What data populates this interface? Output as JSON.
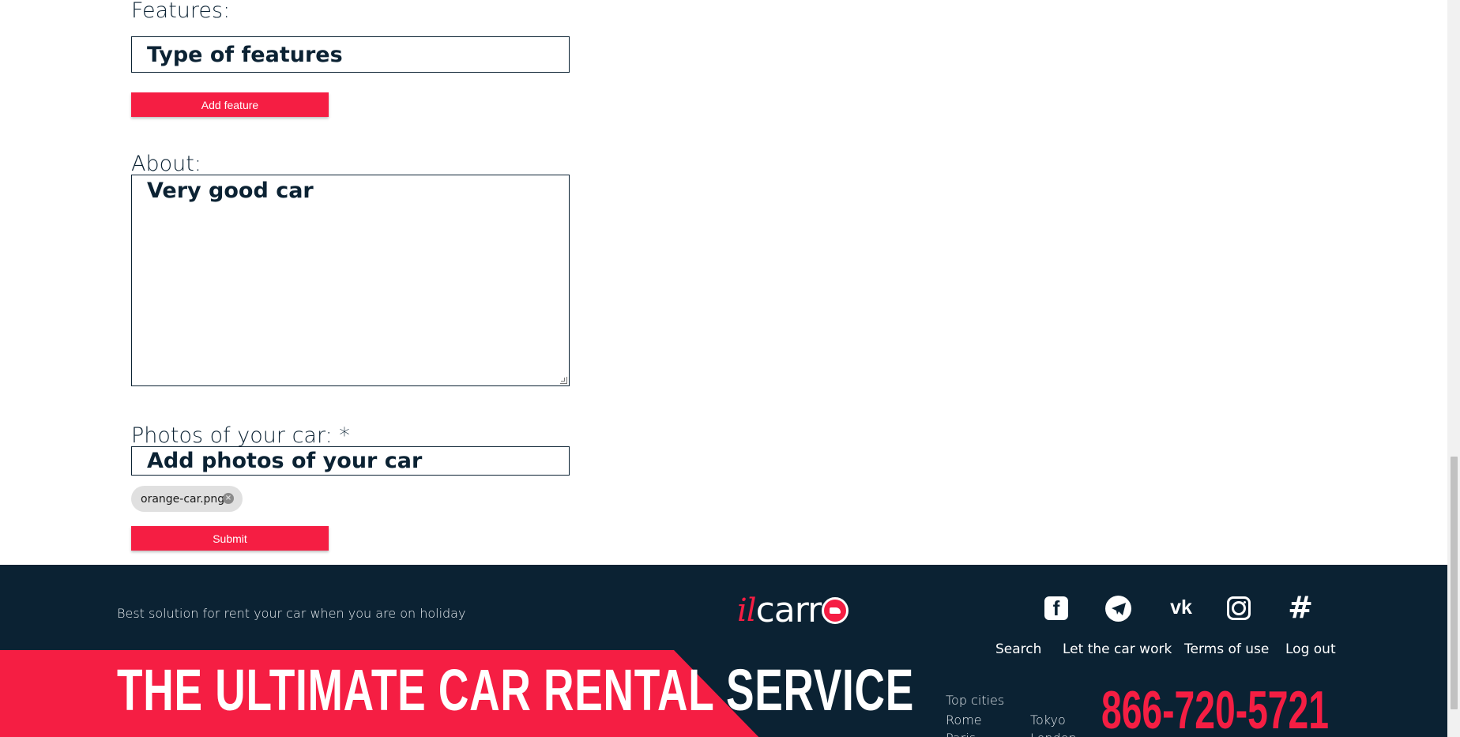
{
  "form": {
    "features": {
      "label": "Features:",
      "placeholder": "Type of features",
      "add_button": "Add feature"
    },
    "about": {
      "label": "About:",
      "value": "Very good car"
    },
    "photos": {
      "label": "Photos of your car: *",
      "placeholder": "Add photos of your car",
      "files": [
        {
          "name": "orange-car.png"
        }
      ]
    },
    "submit_label": "Submit"
  },
  "footer": {
    "tagline": "Best solution for rent your car when you are on holiday",
    "logo": {
      "prefix": "il",
      "word": "carr"
    },
    "social": [
      "facebook-icon",
      "telegram-icon",
      "vk-icon",
      "instagram-icon",
      "slack-icon"
    ],
    "nav": {
      "search": "Search",
      "let_car_work": "Let the car work",
      "terms": "Terms of use",
      "logout": "Log out"
    },
    "banner_title": "THE ULTIMATE CAR RENTAL SERVICE",
    "top_cities": {
      "title": "Top cities",
      "cities": [
        "Rome",
        "Tokyo",
        "Paris",
        "London"
      ]
    },
    "phone": "866-720-5721"
  },
  "colors": {
    "accent": "#f51e43",
    "dark": "#0b2233",
    "chip": "#e0e0e0"
  }
}
